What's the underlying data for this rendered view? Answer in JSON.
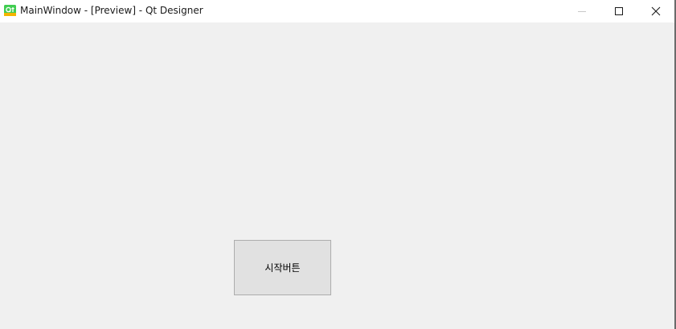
{
  "window": {
    "title": "MainWindow - [Preview] - Qt Designer",
    "app_icon": "qt-logo-icon",
    "caption_buttons": {
      "minimize_icon": "minimize-icon",
      "maximize_icon": "maximize-icon",
      "close_icon": "close-icon"
    }
  },
  "main": {
    "start_button_label": "시작버튼"
  },
  "colors": {
    "client_background": "#f0f0f0",
    "button_background": "#e1e1e1",
    "button_border": "#adadad",
    "qt_green": "#41cd52"
  }
}
